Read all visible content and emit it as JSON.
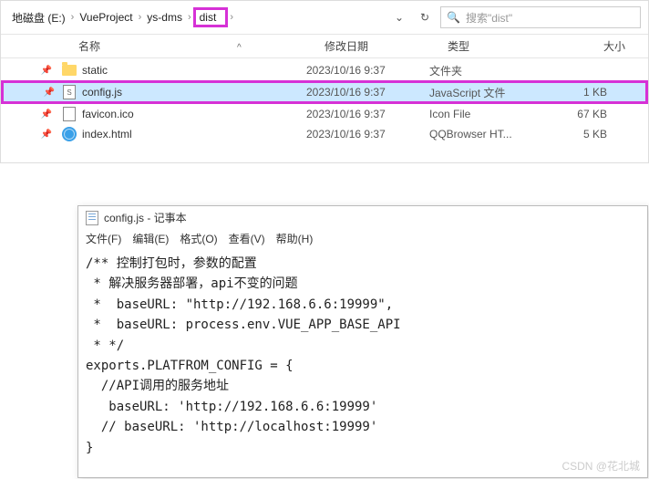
{
  "breadcrumb": {
    "root": "地磁盘 (E:)",
    "p1": "VueProject",
    "p2": "ys-dms",
    "p3": "dist"
  },
  "search": {
    "placeholder": "搜索\"dist\""
  },
  "headers": {
    "name": "名称",
    "date": "修改日期",
    "type": "类型",
    "size": "大小",
    "sort_ind": "^"
  },
  "files": [
    {
      "name": "static",
      "date": "2023/10/16 9:37",
      "type": "文件夹",
      "size": ""
    },
    {
      "name": "config.js",
      "date": "2023/10/16 9:37",
      "type": "JavaScript 文件",
      "size": "1 KB"
    },
    {
      "name": "favicon.ico",
      "date": "2023/10/16 9:37",
      "type": "Icon File",
      "size": "67 KB"
    },
    {
      "name": "index.html",
      "date": "2023/10/16 9:37",
      "type": "QQBrowser HT...",
      "size": "5 KB"
    }
  ],
  "notepad": {
    "title": "config.js - 记事本",
    "menu": {
      "file": "文件(F)",
      "edit": "编辑(E)",
      "format": "格式(O)",
      "view": "查看(V)",
      "help": "帮助(H)"
    },
    "content": "/** 控制打包时，参数的配置\n * 解决服务器部署，api不变的问题\n *  baseURL: \"http://192.168.6.6:19999\",\n *  baseURL: process.env.VUE_APP_BASE_API\n * */\nexports.PLATFROM_CONFIG = {\n  //API调用的服务地址\n   baseURL: 'http://192.168.6.6:19999'\n  // baseURL: 'http://localhost:19999'\n}"
  },
  "watermark": "CSDN @花北城"
}
